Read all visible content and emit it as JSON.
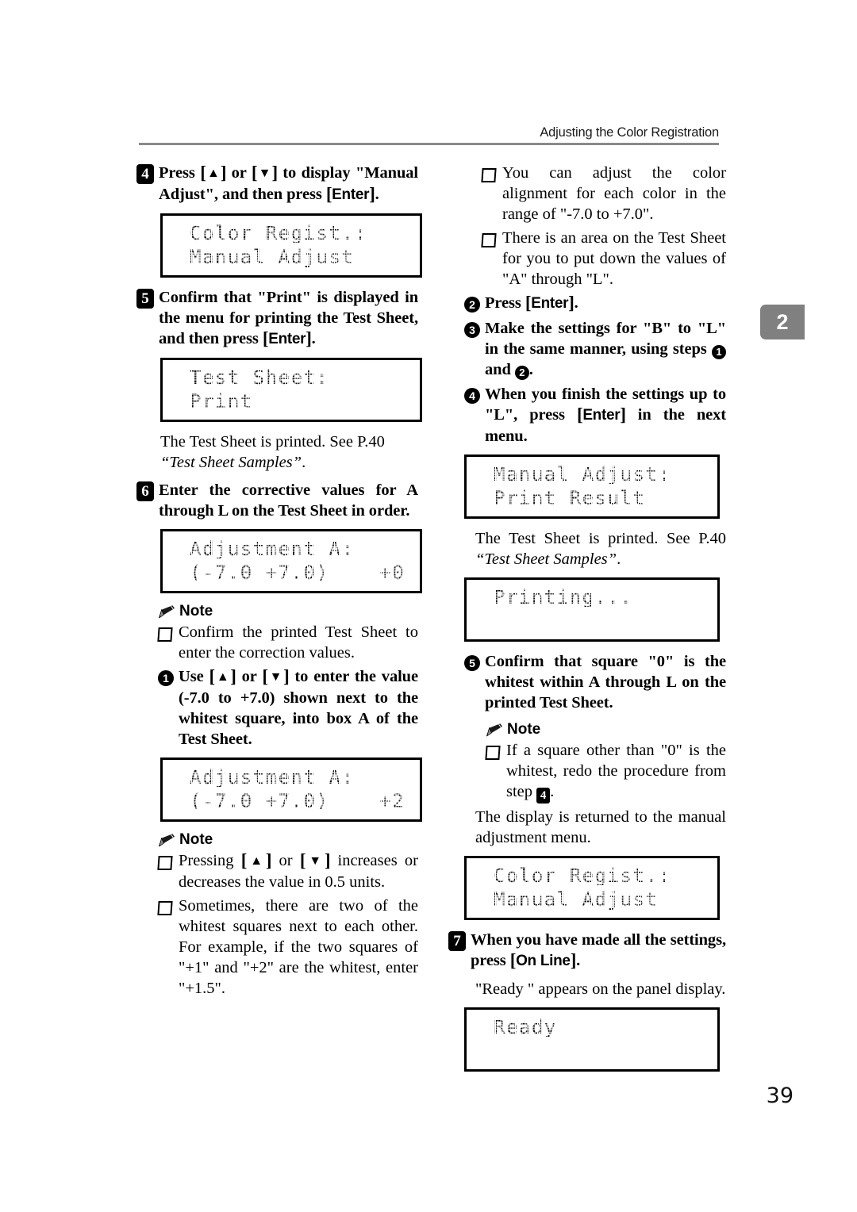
{
  "header": {
    "title": "Adjusting the Color Registration"
  },
  "chapter_tab": {
    "number": "2"
  },
  "folio": {
    "page_number": "39"
  },
  "left_column": {
    "step4": {
      "number": "4",
      "text_part1": "Press ",
      "key_up": "▲",
      "text_or": " or ",
      "key_down": "▼",
      "text_part2": " to display \"Manual Adjust\", and then press ",
      "key_enter": "Enter",
      "text_end": "."
    },
    "lcd1": {
      "line1": "Color Regist.:",
      "line2": "Manual Adjust"
    },
    "step5": {
      "number": "5",
      "text_part1": "Confirm that \"Print\" is displayed in the menu for printing the Test Sheet, and then press ",
      "key_enter": "Enter",
      "text_end": "."
    },
    "lcd2": {
      "line1": "Test Sheet:",
      "line2": "Print"
    },
    "para1": {
      "plain": "The Test Sheet is printed.  See P.40 ",
      "italic": "“Test Sheet Samples”",
      "tail": "."
    },
    "step6": {
      "number": "6",
      "text": "Enter the corrective values for A through L on the Test Sheet in order."
    },
    "lcd3": {
      "line1": "Adjustment A:",
      "line2": "(-7.0 +7.0)    +0"
    },
    "note1": {
      "label": "Note",
      "bullets": [
        "Confirm the printed Test Sheet to enter the correction values."
      ]
    },
    "substep1": {
      "number": "1",
      "text_part1": "Use ",
      "key_up": "▲",
      "text_or": " or ",
      "key_down": "▼",
      "text_part2": " to enter the value (-7.0 to +7.0) shown next to the whitest square, into box A of the Test Sheet."
    },
    "lcd4": {
      "line1": "Adjustment A:",
      "line2": "(-7.0 +7.0)    +2"
    },
    "note2": {
      "label": "Note",
      "bullet1_part1": "Pressing ",
      "bullet1_key_up": "▲",
      "bullet1_or": " or ",
      "bullet1_key_down": "▼",
      "bullet1_part2": " increases or decreases the value in 0.5 units.",
      "bullet2": "Sometimes, there are two of the whitest squares next to each other.  For example, if the two squares of \"+1\" and \"+2\" are the whitest, enter \"+1.5\"."
    }
  },
  "right_column": {
    "top_bullets": [
      "You can adjust the color alignment for each color in the range of \"-7.0 to +7.0\".",
      "There is an area on the Test Sheet for you to put down the values of \"A\" through \"L\"."
    ],
    "substep2": {
      "number": "2",
      "text_part1": "Press ",
      "key_enter": "Enter",
      "text_end": "."
    },
    "substep3": {
      "number": "3",
      "text_part1": "Make the settings for \"B\" to \"L\" in the same manner, using steps ",
      "circ1": "1",
      "text_and": " and ",
      "circ2": "2",
      "text_end": "."
    },
    "substep4": {
      "number": "4",
      "text_part1": "When you finish the settings up to \"L\", press ",
      "key_enter": "Enter",
      "text_end": " in the next menu."
    },
    "lcd5": {
      "line1": "Manual Adjust:",
      "line2": "Print Result"
    },
    "para1": {
      "plain": "The Test Sheet is printed.  See P.40 ",
      "italic": "“Test Sheet Samples”",
      "tail": "."
    },
    "lcd6": {
      "line1": "Printing...",
      "line2": ""
    },
    "substep5": {
      "number": "5",
      "text": "Confirm that square \"0\" is the whitest within A through L on the printed Test Sheet."
    },
    "note1": {
      "label": "Note",
      "bullet1_part1": "If a square other than \"0\" is the whitest, redo the procedure from step ",
      "bullet1_step": "4",
      "bullet1_part2": "."
    },
    "para2": {
      "text": "The display is returned to the manual adjustment menu."
    },
    "lcd7": {
      "line1": "Color Regist.:",
      "line2": "Manual Adjust"
    },
    "step7": {
      "number": "7",
      "text_part1": "When you have made all the settings, press ",
      "key_online": "On Line",
      "text_end": "."
    },
    "para3": {
      "text": "\"Ready \" appears on the panel display."
    },
    "lcd8": {
      "line1": "Ready",
      "line2": ""
    }
  }
}
